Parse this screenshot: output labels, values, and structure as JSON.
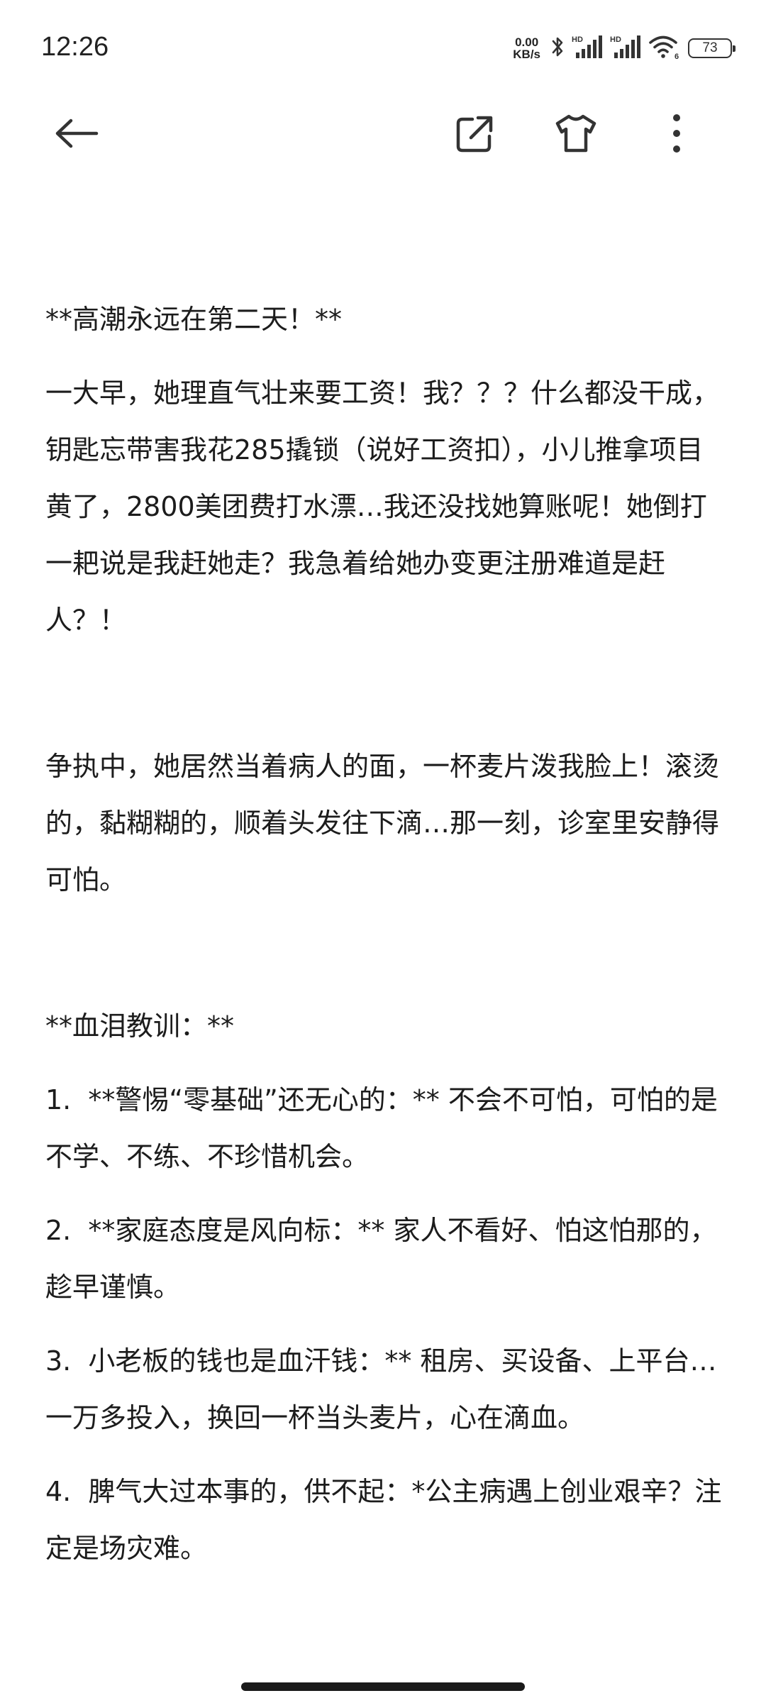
{
  "status_bar": {
    "time": "12:26",
    "net_speed_value": "0.00",
    "net_speed_unit": "KB/s",
    "signal_1_label": "HD",
    "signal_2_label": "HD",
    "wifi_label": "6",
    "battery_level": "73"
  },
  "toolbar": {
    "icons": [
      "back-arrow-icon",
      "share-icon",
      "theme-shirt-icon",
      "more-vertical-icon"
    ]
  },
  "article": {
    "paragraphs": [
      "**高潮永远在第二天！**",
      "一大早，她理直气壮来要工资！我？？？什么都没干成，钥匙忘带害我花285撬锁（说好工资扣），小儿推拿项目黄了，2800美团费打水漂…我还没找她算账呢！她倒打一耙说是我赶她走？我急着给她办变更注册难道是赶人？！",
      "争执中，她居然当着病人的面，一杯麦片泼我脸上！滚烫的，黏糊糊的，顺着头发往下滴…那一刻，诊室里安静得可怕。",
      "**血泪教训：**",
      "1.  **警惕“零基础”还无心的：** 不会不可怕，可怕的是不学、不练、不珍惜机会。",
      "2.  **家庭态度是风向标：** 家人不看好、怕这怕那的，趁早谨慎。",
      "3.  小老板的钱也是血汗钱：** 租房、买设备、上平台…一万多投入，换回一杯当头麦片，心在滴血。",
      "4.  脾气大过本事的，供不起：*公主病遇上创业艰辛？注定是场灾难。"
    ]
  },
  "colors": {
    "background": "#ffffff",
    "text": "#1c1c1c",
    "icon": "#333333"
  }
}
